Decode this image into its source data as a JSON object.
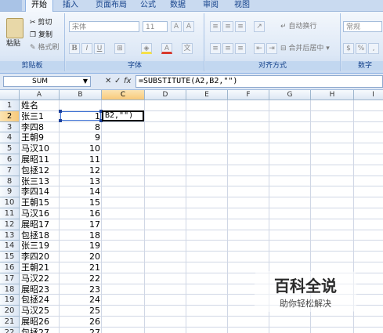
{
  "ribbon_tabs": [
    "开始",
    "插入",
    "页面布局",
    "公式",
    "数据",
    "审阅",
    "视图"
  ],
  "clipboard": {
    "paste": "粘贴",
    "cut": "剪切",
    "copy": "复制",
    "format_painter": "格式刷",
    "group": "剪贴板"
  },
  "font": {
    "name": "宋体",
    "size": "11",
    "group": "字体",
    "bold": "B",
    "italic": "I",
    "underline": "U"
  },
  "alignment": {
    "wrap": "自动换行",
    "merge": "合并后居中",
    "group": "对齐方式"
  },
  "number": {
    "format": "常规",
    "group": "数字"
  },
  "formula_bar": {
    "name_box": "SUM",
    "formula": "=SUBSTITUTE(A2,B2,\"\")"
  },
  "columns": [
    "A",
    "B",
    "C",
    "D",
    "E",
    "F",
    "G",
    "H",
    "I"
  ],
  "rows": [
    {
      "n": "1",
      "a": "姓名",
      "b": ""
    },
    {
      "n": "2",
      "a": "张三1",
      "b": "1"
    },
    {
      "n": "3",
      "a": "李四8",
      "b": "8"
    },
    {
      "n": "4",
      "a": "王朝9",
      "b": "9"
    },
    {
      "n": "5",
      "a": "马汉10",
      "b": "10"
    },
    {
      "n": "6",
      "a": "展昭11",
      "b": "11"
    },
    {
      "n": "7",
      "a": "包拯12",
      "b": "12"
    },
    {
      "n": "8",
      "a": "张三13",
      "b": "13"
    },
    {
      "n": "9",
      "a": "李四14",
      "b": "14"
    },
    {
      "n": "10",
      "a": "王朝15",
      "b": "15"
    },
    {
      "n": "11",
      "a": "马汉16",
      "b": "16"
    },
    {
      "n": "12",
      "a": "展昭17",
      "b": "17"
    },
    {
      "n": "13",
      "a": "包拯18",
      "b": "18"
    },
    {
      "n": "14",
      "a": "张三19",
      "b": "19"
    },
    {
      "n": "15",
      "a": "李四20",
      "b": "20"
    },
    {
      "n": "16",
      "a": "王朝21",
      "b": "21"
    },
    {
      "n": "17",
      "a": "马汉22",
      "b": "22"
    },
    {
      "n": "18",
      "a": "展昭23",
      "b": "23"
    },
    {
      "n": "19",
      "a": "包拯24",
      "b": "24"
    },
    {
      "n": "20",
      "a": "马汉25",
      "b": "25"
    },
    {
      "n": "21",
      "a": "展昭26",
      "b": "26"
    },
    {
      "n": "22",
      "a": "包拯27",
      "b": "27"
    }
  ],
  "active_cell": {
    "ref": "C2",
    "content": "B2,\"\")"
  },
  "watermark": {
    "title": "百科全说",
    "subtitle": "助你轻松解决"
  }
}
